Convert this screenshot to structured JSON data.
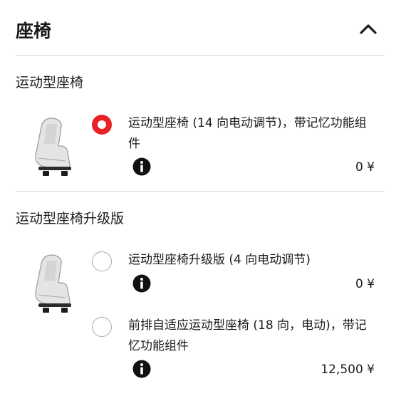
{
  "header": {
    "title": "座椅",
    "collapse_icon": "chevron-up-icon"
  },
  "sections": [
    {
      "title": "运动型座椅",
      "options": [
        {
          "label": "运动型座椅 (14 向电动调节)，带记忆功能组件",
          "price": "0 ¥",
          "selected": true
        }
      ]
    },
    {
      "title": "运动型座椅升级版",
      "options": [
        {
          "label": "运动型座椅升级版 (4 向电动调节)",
          "price": "0 ¥",
          "selected": false
        },
        {
          "label": "前排自适应运动型座椅 (18 向，电动)，带记忆功能组件",
          "price": "12,500 ¥",
          "selected": false
        }
      ]
    }
  ],
  "colors": {
    "accent": "#e82127",
    "divider": "#d6d6d6",
    "text": "#1a1a1a"
  },
  "icons": {
    "info": "info-icon",
    "seat": "seat-image"
  }
}
